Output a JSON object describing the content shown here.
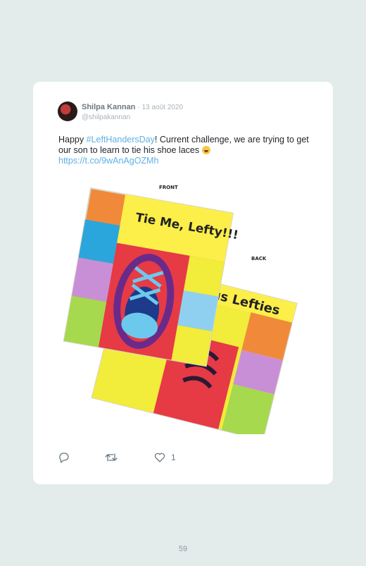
{
  "tweet": {
    "author_name": "Shilpa Kannan",
    "date": "· 13 août 2020",
    "handle": "@shilpakannan",
    "text_before": "Happy ",
    "hashtag": "#LeftHandersDay",
    "text_after": "! Current challenge, we are trying to get our son to learn to tie his shoe laces ",
    "emoji": "grinning-sweat-emoji",
    "link": "https://t.co/9wAnAgOZMh",
    "like_count": "1"
  },
  "media": {
    "front_label": "FRONT",
    "back_label": "BACK",
    "front_title": "Tie Me, Lefty!!!",
    "back_title": "us Lefties"
  },
  "icons": {
    "reply": "reply-icon",
    "retweet": "retweet-icon",
    "like": "heart-icon"
  },
  "page_number": "59",
  "colors": {
    "link": "#5fb0e5",
    "background": "#e3ebeb"
  }
}
